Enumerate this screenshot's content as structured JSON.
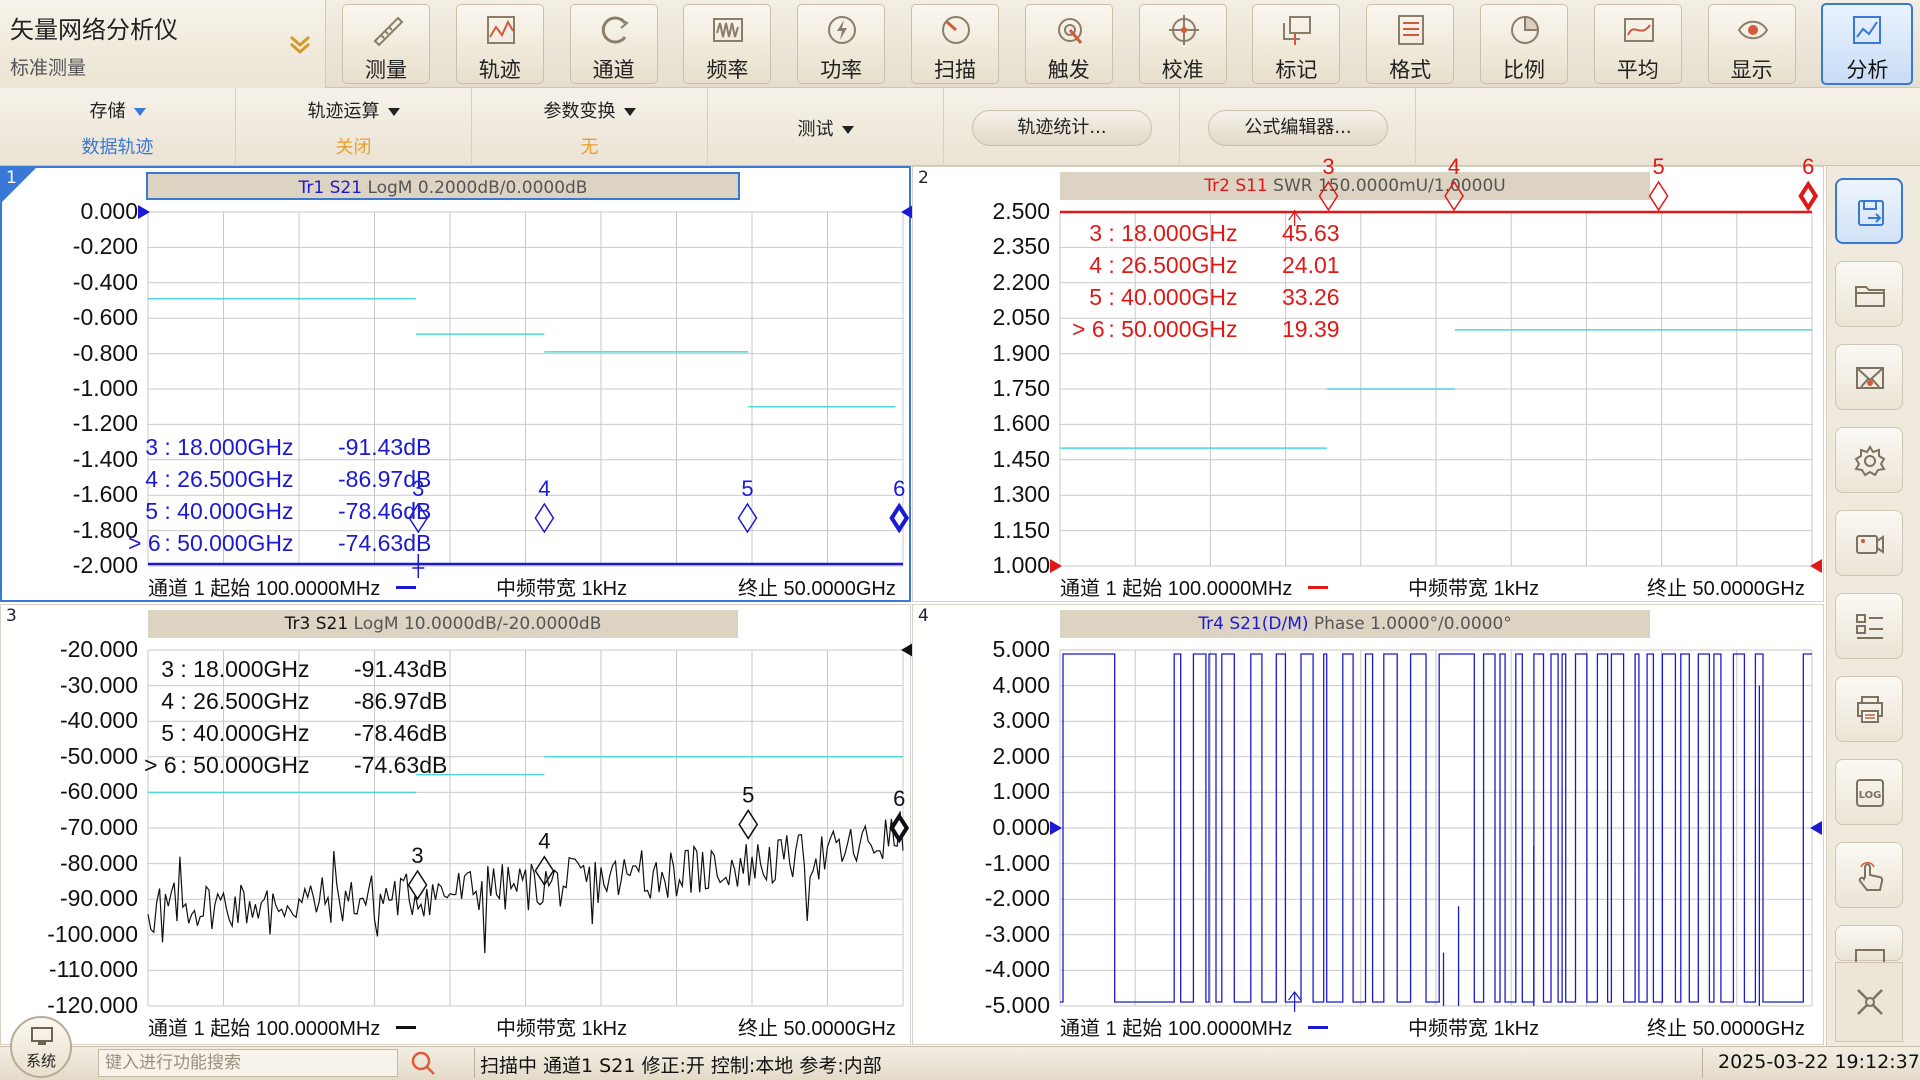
{
  "app": {
    "title": "矢量网络分析仪",
    "subtitle": "标准测量"
  },
  "toolbar": [
    "测量",
    "轨迹",
    "通道",
    "频率",
    "功率",
    "扫描",
    "触发",
    "校准",
    "标记",
    "格式",
    "比例",
    "平均",
    "显示",
    "分析"
  ],
  "toolbar_active": "分析",
  "subbar": {
    "store": {
      "label": "存储",
      "value": "数据轨迹"
    },
    "trace_math": {
      "label": "轨迹运算",
      "value": "关闭"
    },
    "param_conv": {
      "label": "参数变换",
      "value": "无"
    },
    "test": {
      "label": "测试"
    },
    "trace_stats": "轨迹统计...",
    "formula": "公式编辑器..."
  },
  "colors": {
    "blue": "#1a1ad4",
    "red": "#e01818",
    "black": "#111111",
    "cyan": "#4fd6dd",
    "accent": "#3a78d6"
  },
  "sidebar_icons": [
    "save-icon",
    "folder-icon",
    "mail-icon",
    "settings-icon",
    "camera-icon",
    "list-icon",
    "printer-icon",
    "log-icon",
    "touch-icon",
    "keyboard-icon"
  ],
  "panels": [
    {
      "num": "1",
      "trace": "Tr1 S21",
      "fmt": "LogM 0.2000dB/0.0000dB",
      "color": "#1a1ad4",
      "yticks": [
        "0.000",
        "-0.200",
        "-0.400",
        "-0.600",
        "-0.800",
        "-1.000",
        "-1.200",
        "-1.400",
        "-1.600",
        "-1.800",
        "-2.000"
      ],
      "footer": {
        "start": "通道 1 起始 100.0000MHz",
        "ifbw": "中频带宽 1kHz",
        "stop": "终止 50.0000GHz"
      },
      "markers": [
        {
          "id": "3",
          "freq": ": 18.000GHz",
          "val": "-91.43dB",
          "active": false
        },
        {
          "id": "4",
          "freq": ": 26.500GHz",
          "val": "-86.97dB",
          "active": false
        },
        {
          "id": "5",
          "freq": ": 40.000GHz",
          "val": "-78.46dB",
          "active": false
        },
        {
          "id": "6",
          "freq": ": 50.000GHz",
          "val": "-74.63dB",
          "active": true
        }
      ]
    },
    {
      "num": "2",
      "trace": "Tr2 S11",
      "fmt": "SWR 150.0000mU/1.0000U",
      "color": "#e01818",
      "yticks": [
        "2.500",
        "2.350",
        "2.200",
        "2.050",
        "1.900",
        "1.750",
        "1.600",
        "1.450",
        "1.300",
        "1.150",
        "1.000"
      ],
      "footer": {
        "start": "通道 1 起始 100.0000MHz",
        "ifbw": "中频带宽 1kHz",
        "stop": "终止 50.0000GHz"
      },
      "markers": [
        {
          "id": "3",
          "freq": ": 18.000GHz",
          "val": "45.63",
          "active": false
        },
        {
          "id": "4",
          "freq": ": 26.500GHz",
          "val": "24.01",
          "active": false
        },
        {
          "id": "5",
          "freq": ": 40.000GHz",
          "val": "33.26",
          "active": false
        },
        {
          "id": "6",
          "freq": ": 50.000GHz",
          "val": "19.39",
          "active": true
        }
      ]
    },
    {
      "num": "3",
      "trace": "Tr3 S21",
      "fmt": "LogM 10.0000dB/-20.0000dB",
      "color": "#111111",
      "yticks": [
        "-20.000",
        "-30.000",
        "-40.000",
        "-50.000",
        "-60.000",
        "-70.000",
        "-80.000",
        "-90.000",
        "-100.000",
        "-110.000",
        "-120.000"
      ],
      "footer": {
        "start": "通道 1 起始 100.0000MHz",
        "ifbw": "中频带宽 1kHz",
        "stop": "终止 50.0000GHz"
      },
      "markers": [
        {
          "id": "3",
          "freq": ": 18.000GHz",
          "val": "-91.43dB",
          "active": false
        },
        {
          "id": "4",
          "freq": ": 26.500GHz",
          "val": "-86.97dB",
          "active": false
        },
        {
          "id": "5",
          "freq": ": 40.000GHz",
          "val": "-78.46dB",
          "active": false
        },
        {
          "id": "6",
          "freq": ": 50.000GHz",
          "val": "-74.63dB",
          "active": true
        }
      ]
    },
    {
      "num": "4",
      "trace": "Tr4 S21(D/M)",
      "fmt": "Phase 1.0000°/0.0000°",
      "color": "#1a1ad4",
      "yticks": [
        "5.000",
        "4.000",
        "3.000",
        "2.000",
        "1.000",
        "0.000",
        "-1.000",
        "-2.000",
        "-3.000",
        "-4.000",
        "-5.000"
      ],
      "footer": {
        "start": "通道 1 起始 100.0000MHz",
        "ifbw": "中频带宽 1kHz",
        "stop": "终止 50.0000GHz"
      },
      "markers": []
    }
  ],
  "status": {
    "system": "系统",
    "search_placeholder": "键入进行功能搜索",
    "text": "扫描中 通道1 S21 修正:开 控制:本地 参考:内部",
    "clock": "2025-03-22 19:12:37"
  }
}
